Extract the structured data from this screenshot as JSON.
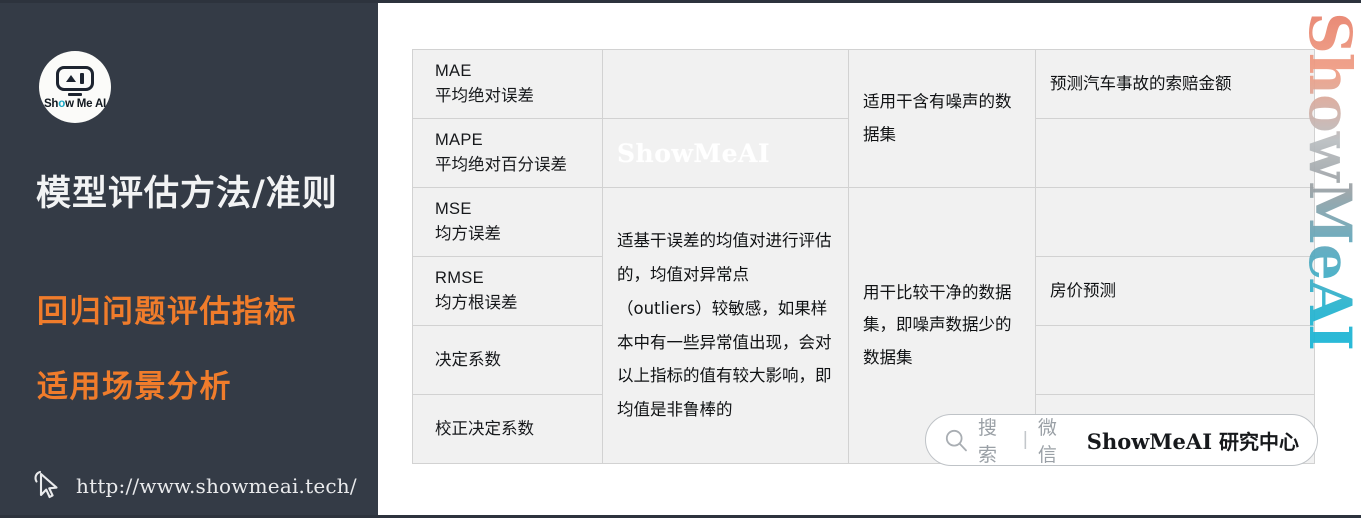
{
  "sidebar": {
    "logo": {
      "icon": "showmeai-robot-logo",
      "text_pre": "Sh",
      "text_o": "o",
      "text_post": "w Me AI"
    },
    "title": "模型评估方法/准则",
    "subtitle_1": "回归问题评估指标",
    "subtitle_2": "适用场景分析",
    "footer_url": "http://www.showmeai.tech/",
    "cursor_icon": "cursor-arrow-icon",
    "colors": {
      "background": "#343b46",
      "title": "#f2f3f4",
      "accent": "#f07c2b",
      "url": "#e9eaec"
    }
  },
  "table": {
    "rows": [
      {
        "metric_abbr": "MAE",
        "metric_cn": "平均绝对误差"
      },
      {
        "metric_abbr": "MAPE",
        "metric_cn": "平均绝对百分误差"
      },
      {
        "metric_abbr": "MSE",
        "metric_cn": "均方误差"
      },
      {
        "metric_abbr": "RMSE",
        "metric_cn": "均方根误差"
      },
      {
        "metric_abbr": "",
        "metric_cn": "决定系数"
      },
      {
        "metric_abbr": "",
        "metric_cn": "校正决定系数"
      }
    ],
    "description_cell": "适基干误差的均值对进行评估的，均值对异常点（outliers）较敏感，如果样本中有一些异常值出现，会对以上指标的值有较大影响，即均值是非鲁棒的",
    "description_watermark": "ShowMeAI",
    "usecase_top": "适用干含有噪声的数据集",
    "usecase_bottom": "用干比较干净的数据集，即噪声数据少的数据集",
    "example_top": "预测汽车事故的索赔金额",
    "example_bottom": "房价预测",
    "colors": {
      "cell_background": "#f1f1f1",
      "grid_line": "#d2d2d2",
      "text": "#101214"
    }
  },
  "watermark_vertical": {
    "text": "ShowMeAI",
    "gradient_from": "#16b5d6",
    "gradient_to": "#e8806a"
  },
  "search_pill": {
    "magnifier_icon": "search-icon",
    "search_label": "搜索",
    "divider": "|",
    "channel_label": "微信",
    "brand_latin": "ShowMeAI",
    "brand_cn": " 研究中心"
  }
}
